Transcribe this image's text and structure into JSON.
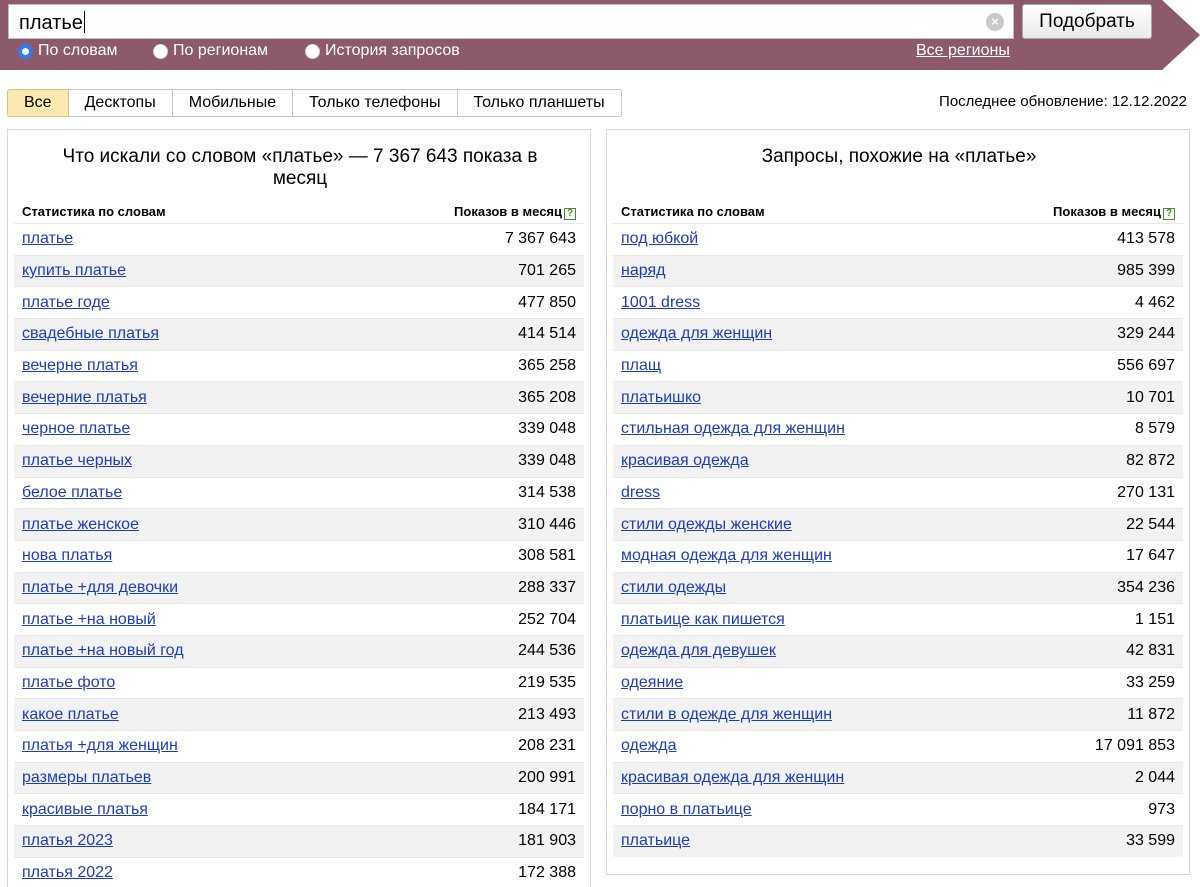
{
  "search": {
    "query": "платье",
    "submit_label": "Подобрать"
  },
  "search_modes": [
    {
      "label": "По словам",
      "checked": true
    },
    {
      "label": "По регионам",
      "checked": false
    },
    {
      "label": "История запросов",
      "checked": false
    }
  ],
  "regions_link": "Все регионы",
  "tabs": [
    {
      "label": "Все",
      "active": true
    },
    {
      "label": "Десктопы",
      "active": false
    },
    {
      "label": "Мобильные",
      "active": false
    },
    {
      "label": "Только телефоны",
      "active": false
    },
    {
      "label": "Только планшеты",
      "active": false
    }
  ],
  "last_update": "Последнее обновление: 12.12.2022",
  "left_panel": {
    "title": "Что искали со словом «платье» — 7 367 643 показа в месяц",
    "col_words": "Статистика по словам",
    "col_count": "Показов в месяц",
    "rows": [
      {
        "phrase": "платье",
        "count": "7 367 643"
      },
      {
        "phrase": "купить платье",
        "count": "701 265"
      },
      {
        "phrase": "платье годе",
        "count": "477 850"
      },
      {
        "phrase": "свадебные платья",
        "count": "414 514"
      },
      {
        "phrase": "вечерне платья",
        "count": "365 258"
      },
      {
        "phrase": "вечерние платья",
        "count": "365 208"
      },
      {
        "phrase": "черное платье",
        "count": "339 048"
      },
      {
        "phrase": "платье черных",
        "count": "339 048"
      },
      {
        "phrase": "белое платье",
        "count": "314 538"
      },
      {
        "phrase": "платье женское",
        "count": "310 446"
      },
      {
        "phrase": "нова платья",
        "count": "308 581"
      },
      {
        "phrase": "платье +для девочки",
        "count": "288 337"
      },
      {
        "phrase": "платье +на новый",
        "count": "252 704"
      },
      {
        "phrase": "платье +на новый год",
        "count": "244 536"
      },
      {
        "phrase": "платье фото",
        "count": "219 535"
      },
      {
        "phrase": "какое платье",
        "count": "213 493"
      },
      {
        "phrase": "платья +для женщин",
        "count": "208 231"
      },
      {
        "phrase": "размеры платьев",
        "count": "200 991"
      },
      {
        "phrase": "красивые платья",
        "count": "184 171"
      },
      {
        "phrase": "платья 2023",
        "count": "181 903"
      },
      {
        "phrase": "платья 2022",
        "count": "172 388"
      }
    ]
  },
  "right_panel": {
    "title": "Запросы, похожие на «платье»",
    "col_words": "Статистика по словам",
    "col_count": "Показов в месяц",
    "rows": [
      {
        "phrase": "под юбкой",
        "count": "413 578"
      },
      {
        "phrase": "наряд",
        "count": "985 399"
      },
      {
        "phrase": "1001 dress",
        "count": "4 462"
      },
      {
        "phrase": "одежда для женщин",
        "count": "329 244"
      },
      {
        "phrase": "плащ",
        "count": "556 697"
      },
      {
        "phrase": "платьишко",
        "count": "10 701"
      },
      {
        "phrase": "стильная одежда для женщин",
        "count": "8 579"
      },
      {
        "phrase": "красивая одежда",
        "count": "82 872"
      },
      {
        "phrase": "dress",
        "count": "270 131"
      },
      {
        "phrase": "стили одежды женские",
        "count": "22 544"
      },
      {
        "phrase": "модная одежда для женщин",
        "count": "17 647"
      },
      {
        "phrase": "стили одежды",
        "count": "354 236"
      },
      {
        "phrase": "платьице как пишется",
        "count": "1 151"
      },
      {
        "phrase": "одежда для девушек",
        "count": "42 831"
      },
      {
        "phrase": "одеяние",
        "count": "33 259"
      },
      {
        "phrase": "стили в одежде для женщин",
        "count": "11 872"
      },
      {
        "phrase": "одежда",
        "count": "17 091 853"
      },
      {
        "phrase": "красивая одежда для женщин",
        "count": "2 044"
      },
      {
        "phrase": "порно в платьице",
        "count": "973"
      },
      {
        "phrase": "платьице",
        "count": "33 599"
      }
    ]
  },
  "icons": {
    "clear": "clear-icon",
    "help": "help-icon"
  },
  "colors": {
    "header_bg": "#8c5a6b",
    "link": "#1a3dc1",
    "active_tab": "#fbe9b0"
  }
}
